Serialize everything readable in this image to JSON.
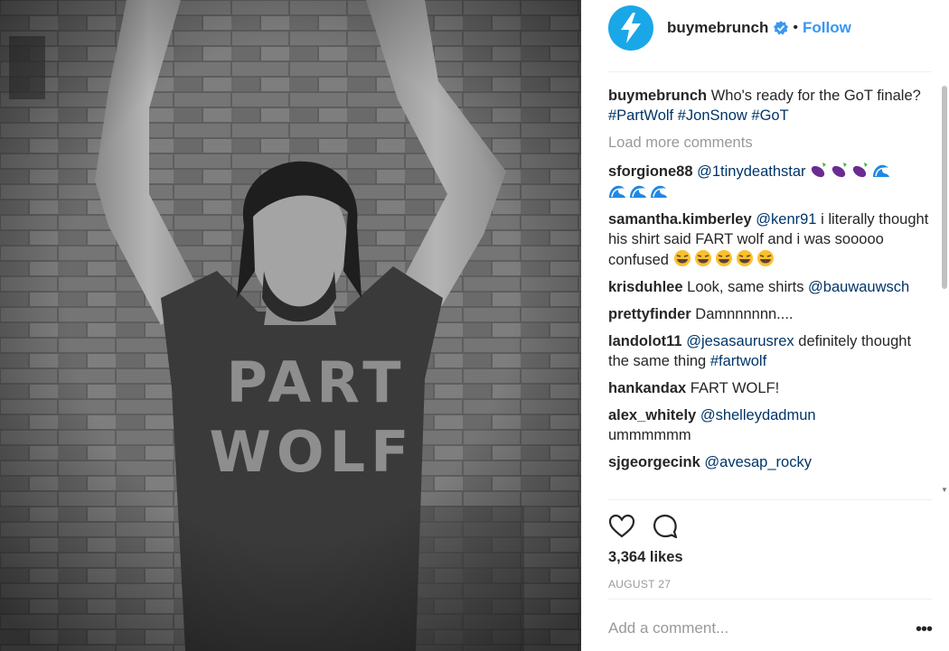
{
  "post": {
    "username": "buymebrunch",
    "follow_label": "Follow",
    "caption": {
      "user": "buymebrunch",
      "text": "Who's ready for the GoT finale?",
      "tags": [
        "#PartWolf",
        "#JonSnow",
        "#GoT"
      ]
    },
    "shirt_text": [
      "PART",
      "WOLF"
    ],
    "load_more": "Load more comments",
    "likes": "3,364 likes",
    "date": "AUGUST 27",
    "add_comment_placeholder": "Add a comment...",
    "more_label": "•••"
  },
  "comments": [
    {
      "user": "sforgione88",
      "mention": "@1tinydeathstar",
      "emoji": [
        "eggplant",
        "eggplant",
        "eggplant",
        "wave",
        "wave",
        "wave",
        "wave"
      ]
    },
    {
      "user": "samantha.kimberley",
      "mention": "@kenr91",
      "text": "i literally thought his shirt said FART wolf and i was sooooo confused",
      "emoji": [
        "laugh",
        "laugh",
        "laugh",
        "laugh",
        "laugh"
      ]
    },
    {
      "user": "krisduhlee",
      "text": "Look, same shirts",
      "mention": "@bauwauwsch"
    },
    {
      "user": "prettyfinder",
      "text": "Damnnnnnn...."
    },
    {
      "user": "landolot11",
      "mention": "@jesasaurusrex",
      "text": "definitely thought the same thing",
      "tag": "#fartwolf"
    },
    {
      "user": "hankandax",
      "text": "FART WOLF!"
    },
    {
      "user": "alex_whitely",
      "mention": "@shelleydadmun",
      "text": "ummmmmm"
    },
    {
      "user": "sjgeorgecink",
      "mention": "@avesap_rocky"
    }
  ],
  "icons": {
    "avatar": "lightning-bolt-icon",
    "verified": "verified-badge-icon",
    "like": "heart-icon",
    "comment": "speech-bubble-icon"
  },
  "colors": {
    "avatar_bg": "#1aa7e8",
    "follow": "#3897f0",
    "mention": "#003569",
    "muted": "#999999"
  }
}
